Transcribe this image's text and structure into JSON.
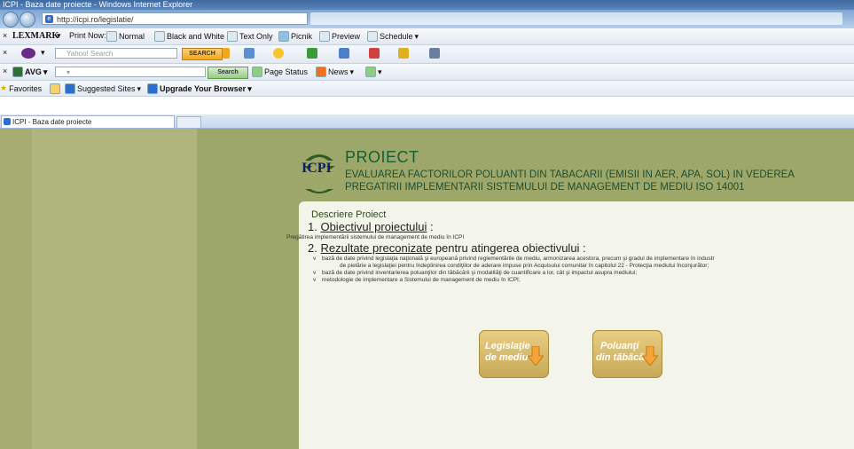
{
  "window": {
    "title": "ICPI - Baza date proiecte - Windows Internet Explorer"
  },
  "address": {
    "url": "http://icpi.ro/legislatie/"
  },
  "lexmark_bar": {
    "brand": "LEXMARK",
    "items": [
      "Print Now:",
      "Normal",
      "Black and White",
      "Text Only",
      "Picnik",
      "Preview",
      "Schedule"
    ]
  },
  "yahoo_bar": {
    "search_placeholder": "Yahoo! Search",
    "search_button": "SEARCH"
  },
  "avg_bar": {
    "brand": "AVG",
    "search_button": "Search",
    "page_status": "Page Status",
    "news": "News"
  },
  "favorites_bar": {
    "favorites": "Favorites",
    "suggested": "Suggested Sites",
    "upgrade": "Upgrade Your Browser"
  },
  "tab": {
    "label": "ICPI - Baza date proiecte"
  },
  "header": {
    "logo_text": "ICPI",
    "title": "PROIECT",
    "subtitle_line1": "EVALUAREA FACTORILOR POLUANTI DIN TABACARII (EMISII IN AER, APA, SOL) IN VEDEREA",
    "subtitle_line2": "PREGATIRII IMPLEMENTARII SISTEMULUI DE MANAGEMENT DE MEDIU ISO 14001"
  },
  "panel": {
    "heading": "Descriere Proiect",
    "item1_num": "1.",
    "item1_title": "Obiectivul proiectului",
    "item1_suffix": " :",
    "item1_text": "Pregătirea implementării sistemului de management de mediu în ICPI",
    "item2_num": "2.",
    "item2_title": "Rezultate preconizate",
    "item2_suffix": " pentru atingerea obiectivului :",
    "bullets": [
      "bază de date privind legislaţia naţională şi europeană privind reglementările de mediu, armonizarea acestora, precum şi gradul de implementare în industr",
      "de pielărie a legislaţiei pentru îndeplinirea condiţiilor de aderare impuse prin Acquisului comunitar în capitolul 22 - Protecţia mediului înconjurător;",
      "bază de date privind inventarierea poluanţilor din tăbăcării şi modalităţi de cuantificare a lor, cât şi impactul asupra mediului;",
      "metodologie de implementare a Sistemului de management de mediu în ICPI;"
    ],
    "bullet_mark": "v"
  },
  "buttons": {
    "legislatie_line1": "Legislaţie",
    "legislatie_line2": "de mediu",
    "poluanti_line1": "Poluanţi",
    "poluanti_line2": "din tăbăcării"
  }
}
